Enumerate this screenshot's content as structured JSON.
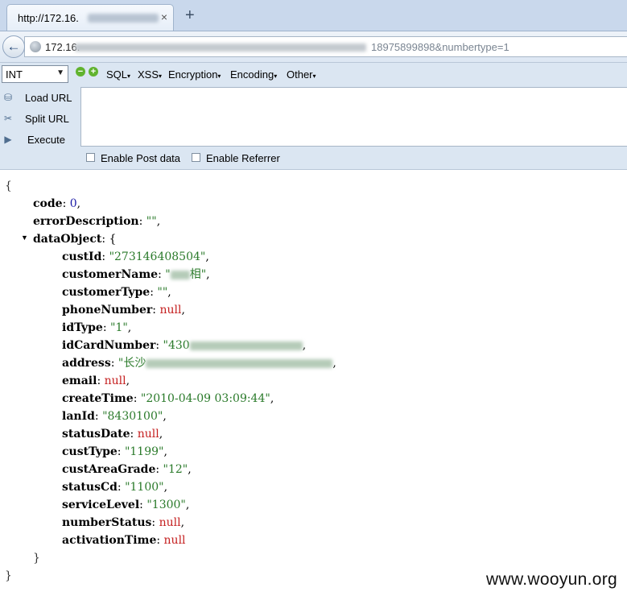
{
  "browser": {
    "tab": {
      "title": "http://172.16.",
      "close": "×"
    },
    "new_tab": "+",
    "back": "←",
    "url": {
      "start": "172.16.",
      "end": "18975899898&numbertype=1"
    }
  },
  "hackbar": {
    "type_select": "INT",
    "minus": "−",
    "plus": "+",
    "menus": [
      "SQL",
      "XSS",
      "Encryption",
      "Encoding",
      "Other"
    ],
    "caret": "▾",
    "actions": {
      "load": "Load URL",
      "split": "Split URL",
      "execute": "Execute"
    },
    "options": {
      "post": "Enable Post data",
      "referrer": "Enable Referrer"
    }
  },
  "json": {
    "open": "{",
    "close": "}",
    "inner_close": "}",
    "toggle": "▼",
    "code": {
      "key": "code",
      "value": "0"
    },
    "errorDescription": {
      "key": "errorDescription",
      "value": "\"\""
    },
    "dataObject_key": "dataObject",
    "dataObject_open": "{",
    "custId": {
      "key": "custId",
      "value": "\"273146408504\""
    },
    "customerName": {
      "key": "customerName",
      "value_prefix": "\"",
      "value_suffix": "相\""
    },
    "customerType": {
      "key": "customerType",
      "value": "\"\""
    },
    "phoneNumber": {
      "key": "phoneNumber",
      "value": "null"
    },
    "idType": {
      "key": "idType",
      "value": "\"1\""
    },
    "idCardNumber": {
      "key": "idCardNumber",
      "value_prefix": "\"430"
    },
    "address": {
      "key": "address",
      "value_prefix": "\"长沙"
    },
    "email": {
      "key": "email",
      "value": "null"
    },
    "createTime": {
      "key": "createTime",
      "value": "\"2010-04-09 03:09:44\""
    },
    "lanId": {
      "key": "lanId",
      "value": "\"8430100\""
    },
    "statusDate": {
      "key": "statusDate",
      "value": "null"
    },
    "custType": {
      "key": "custType",
      "value": "\"1199\""
    },
    "custAreaGrade": {
      "key": "custAreaGrade",
      "value": "\"12\""
    },
    "statusCd": {
      "key": "statusCd",
      "value": "\"1100\""
    },
    "serviceLevel": {
      "key": "serviceLevel",
      "value": "\"1300\""
    },
    "numberStatus": {
      "key": "numberStatus",
      "value": "null"
    },
    "activationTime": {
      "key": "activationTime",
      "value": "null"
    }
  },
  "watermark": "www.wooyun.org",
  "colors": {
    "string": "#2a7a2a",
    "null": "#c52020",
    "number": "#1a1aa6",
    "chrome": "#dbe6f2"
  }
}
